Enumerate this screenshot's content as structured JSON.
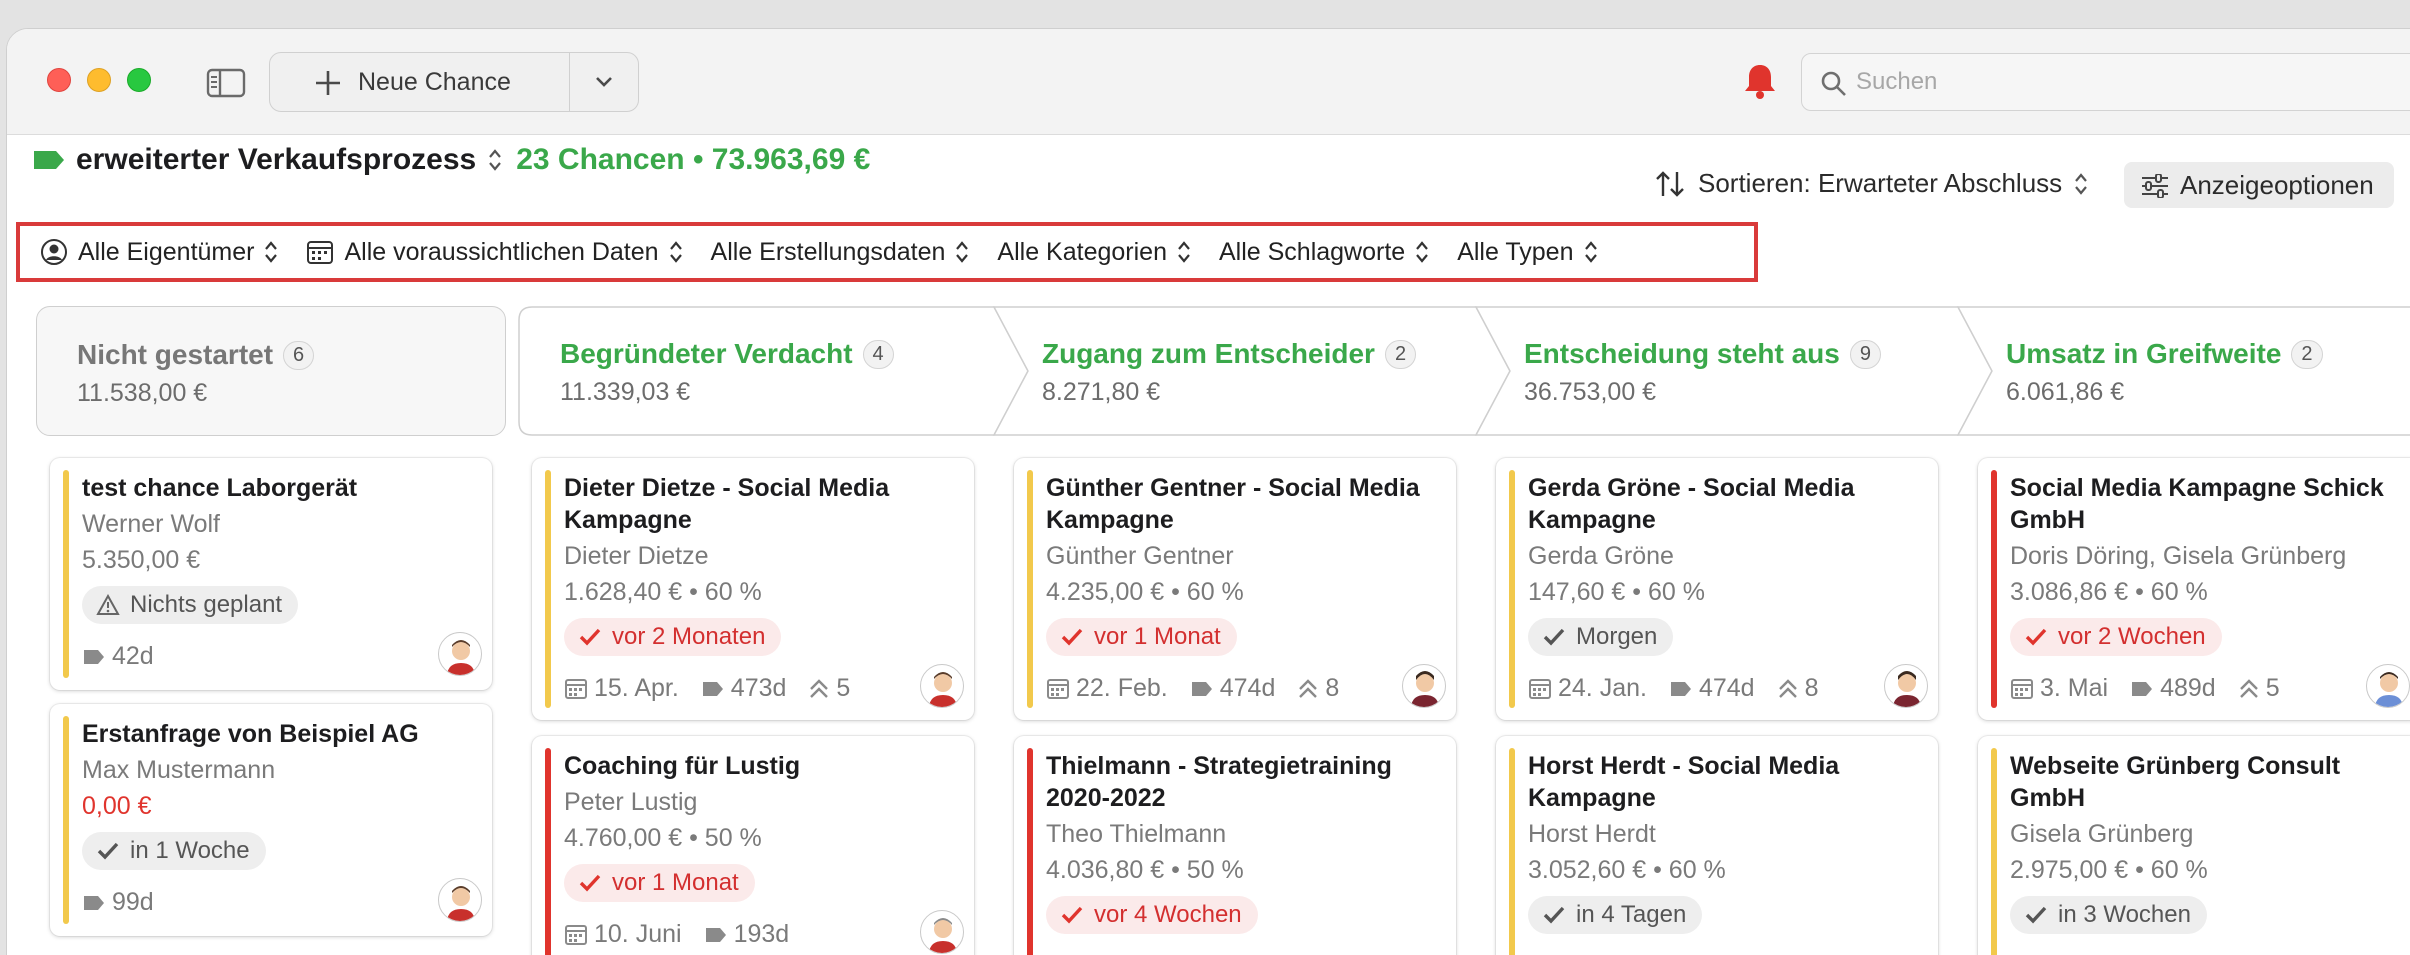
{
  "toolbar": {
    "new_label": "Neue Chance",
    "search_placeholder": "Suchen"
  },
  "header": {
    "pipeline": "erweiterter Verkaufsprozess",
    "stats": "23 Chancen • 73.963,69 €",
    "sort_label": "Sortieren: Erwarteter Abschluss",
    "display_label": "Anzeigeoptionen"
  },
  "filters": [
    {
      "label": "Alle Eigentümer",
      "icon": "person-circle-icon"
    },
    {
      "label": "Alle voraussichtlichen Daten",
      "icon": "calendar-icon"
    },
    {
      "label": "Alle Erstellungsdaten",
      "icon": ""
    },
    {
      "label": "Alle Kategorien",
      "icon": ""
    },
    {
      "label": "Alle Schlagworte",
      "icon": ""
    },
    {
      "label": "Alle Typen",
      "icon": ""
    }
  ],
  "stages": [
    {
      "name": "Nicht gestartet",
      "count": "6",
      "sum": "11.538,00 €"
    },
    {
      "name": "Begründeter Verdacht",
      "count": "4",
      "sum": "11.339,03 €"
    },
    {
      "name": "Zugang zum Entscheider",
      "count": "2",
      "sum": "8.271,80 €"
    },
    {
      "name": "Entscheidung steht aus",
      "count": "9",
      "sum": "36.753,00 €"
    },
    {
      "name": "Umsatz in Greifweite",
      "count": "2",
      "sum": "6.061,86 €"
    }
  ],
  "cards": {
    "c0a": {
      "title": "test chance Laborgerät",
      "person": "Werner Wolf",
      "value": "5.350,00 €",
      "pill": "Nichts geplant",
      "age": "42d"
    },
    "c0b": {
      "title": "Erstanfrage von Beispiel AG",
      "person": "Max Mustermann",
      "value": "0,00 €",
      "pill": "in 1 Woche",
      "age": "99d"
    },
    "c1a": {
      "title": "Dieter Dietze - Social Media Kampagne",
      "person": "Dieter Dietze",
      "value": "1.628,40 € • 60 %",
      "pill": "vor 2 Monaten",
      "date": "15. Apr.",
      "age": "473d",
      "prio": "5"
    },
    "c1b": {
      "title": "Coaching für Lustig",
      "person": "Peter Lustig",
      "value": "4.760,00 € • 50 %",
      "pill": "vor 1 Monat",
      "date": "10. Juni",
      "age": "193d"
    },
    "c2a": {
      "title": "Günther Gentner - Social Media Kampagne",
      "person": "Günther Gentner",
      "value": "4.235,00 € • 60 %",
      "pill": "vor 1 Monat",
      "date": "22. Feb.",
      "age": "474d",
      "prio": "8"
    },
    "c2b": {
      "title": "Thielmann - Strategietraining 2020-2022",
      "person": "Theo Thielmann",
      "value": "4.036,80 € • 50 %",
      "pill": "vor 4 Wochen"
    },
    "c3a": {
      "title": "Gerda Gröne - Social Media Kampagne",
      "person": "Gerda Gröne",
      "value": "147,60 € • 60 %",
      "pill": "Morgen",
      "date": "24. Jan.",
      "age": "474d",
      "prio": "8"
    },
    "c3b": {
      "title": "Horst Herdt - Social Media Kampagne",
      "person": "Horst Herdt",
      "value": "3.052,60 € • 60 %",
      "pill": "in 4 Tagen"
    },
    "c4a": {
      "title": "Social Media Kampagne Schick GmbH",
      "person": "Doris Döring, Gisela Grünberg",
      "value": "3.086,86 € • 60 %",
      "pill": "vor 2 Wochen",
      "date": "3. Mai",
      "age": "489d",
      "prio": "5"
    },
    "c4b": {
      "title": "Webseite Grünberg Consult GmbH",
      "person": "Gisela Grünberg",
      "value": "2.975,00 € • 60 %",
      "pill": "in 3 Wochen"
    }
  },
  "colors": {
    "accent_green": "#3aa84a",
    "overdue_red": "#e0342d",
    "bar_yellow": "#f2c94c",
    "bar_red": "#e0342d"
  }
}
